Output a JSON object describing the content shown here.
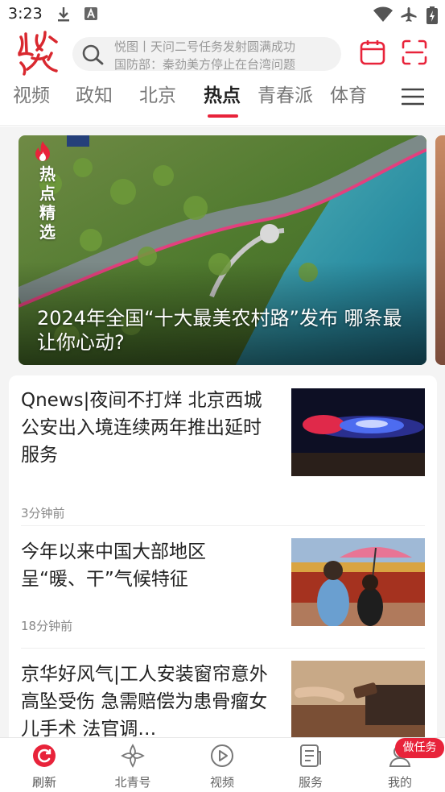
{
  "status_bar": {
    "time": "3:23"
  },
  "header": {
    "search": {
      "line1": "悦图丨天问二号任务发射圆满成功",
      "line2": "国防部：秦劲美方停止在台湾问题"
    }
  },
  "tabs": [
    {
      "label": "视频"
    },
    {
      "label": "政知"
    },
    {
      "label": "北京"
    },
    {
      "label": "热点"
    },
    {
      "label": "青春派"
    },
    {
      "label": "体育"
    }
  ],
  "active_tab": "热点",
  "hero": {
    "badge": "热点精选",
    "title": "2024年全国“十大最美农村路”发布 哪条最让你心动?"
  },
  "news": [
    {
      "title": "Qnews|夜间不打烊 北京西城公安出入境连续两年推出延时服务",
      "time": "3分钟前"
    },
    {
      "title": "今年以来中国大部地区呈“暖、干”气候特征",
      "time": "18分钟前"
    },
    {
      "title": "京华好风气|工人安装窗帘意外高坠受伤 急需赔偿为患骨瘤女儿手术 法官调…",
      "time": ""
    }
  ],
  "bottom_nav": [
    {
      "label": "刷新",
      "icon": "refresh-icon"
    },
    {
      "label": "北青号",
      "icon": "flower-icon"
    },
    {
      "label": "视频",
      "icon": "play-icon"
    },
    {
      "label": "服务",
      "icon": "service-icon"
    },
    {
      "label": "我的",
      "icon": "user-icon"
    }
  ],
  "task_badge": "做任务",
  "colors": {
    "accent": "#e8233a"
  }
}
